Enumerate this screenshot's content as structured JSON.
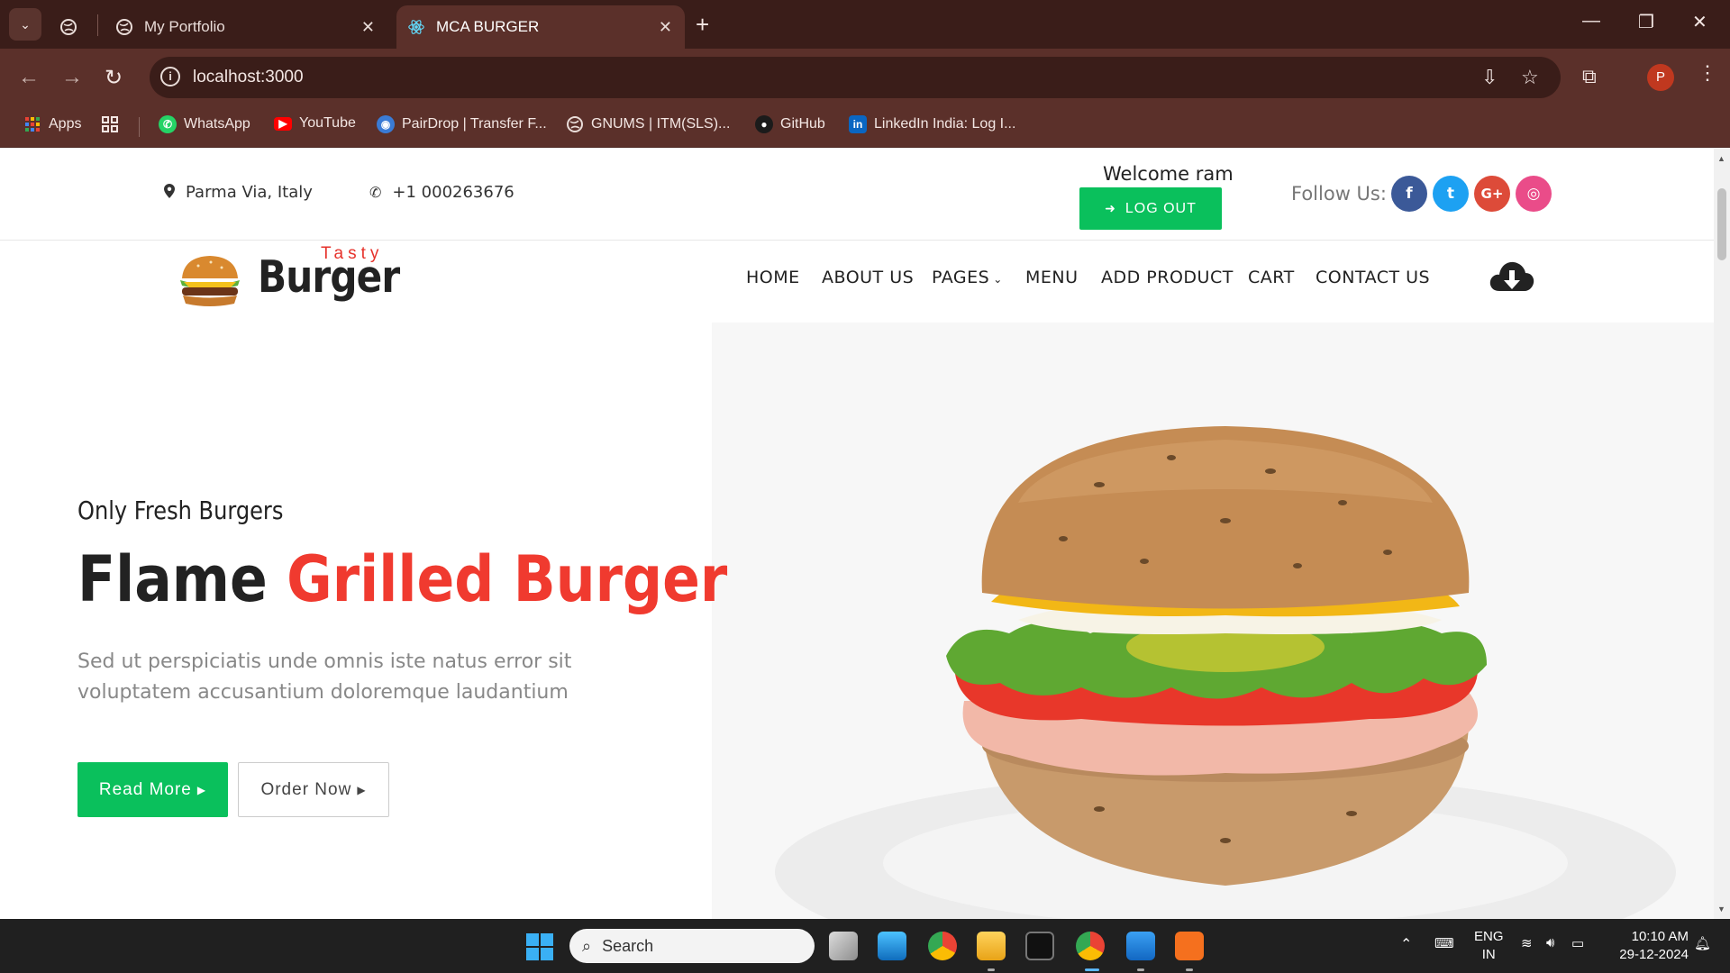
{
  "browser": {
    "tabs": [
      {
        "title": "My Portfolio",
        "icon": "globe-icon"
      },
      {
        "title": "MCA BURGER",
        "icon": "react-icon",
        "active": true
      }
    ],
    "url": "localhost:3000",
    "profile_initial": "P",
    "bookmarks": [
      {
        "label": "Apps",
        "icon": "apps-grid-icon"
      },
      {
        "label": "WhatsApp",
        "icon": "whatsapp-icon"
      },
      {
        "label": "YouTube",
        "icon": "youtube-icon"
      },
      {
        "label": "PairDrop | Transfer F...",
        "icon": "pairdrop-icon"
      },
      {
        "label": "GNUMS | ITM(SLS)...",
        "icon": "globe-icon"
      },
      {
        "label": "GitHub",
        "icon": "github-icon"
      },
      {
        "label": "LinkedIn India: Log I...",
        "icon": "linkedin-icon"
      }
    ]
  },
  "topbar": {
    "location": "Parma Via, Italy",
    "phone": "+1 000263676",
    "welcome": "Welcome ram",
    "logout_label": "LOG OUT",
    "follow_label": "Follow Us:",
    "social": [
      {
        "name": "facebook",
        "glyph": "f",
        "color": "#3b5998"
      },
      {
        "name": "twitter",
        "glyph": "t",
        "color": "#1da1f2"
      },
      {
        "name": "google-plus",
        "glyph": "G+",
        "color": "#dd4b39"
      },
      {
        "name": "dribbble",
        "glyph": "◎",
        "color": "#ea4c89"
      }
    ]
  },
  "logo": {
    "small": "Tasty",
    "word": "Burger"
  },
  "nav": {
    "items": [
      "HOME",
      "ABOUT US",
      "PAGES",
      "MENU",
      "ADD PRODUCT",
      "CART",
      "CONTACT US"
    ]
  },
  "hero": {
    "subtitle": "Only Fresh Burgers",
    "title_plain": "Flame",
    "title_accent": "Grilled Burger",
    "description": "Sed ut perspiciatis unde omnis iste natus error sit voluptatem accusantium doloremque laudantium",
    "read_more": "Read More",
    "order_now": "Order Now"
  },
  "colors": {
    "accent_red": "#f03a2f",
    "accent_green": "#0ac05c",
    "chrome": "#5b302a"
  },
  "taskbar": {
    "search_placeholder": "Search",
    "lang": "ENG",
    "region": "IN",
    "time": "10:10 AM",
    "date": "29-12-2024"
  }
}
